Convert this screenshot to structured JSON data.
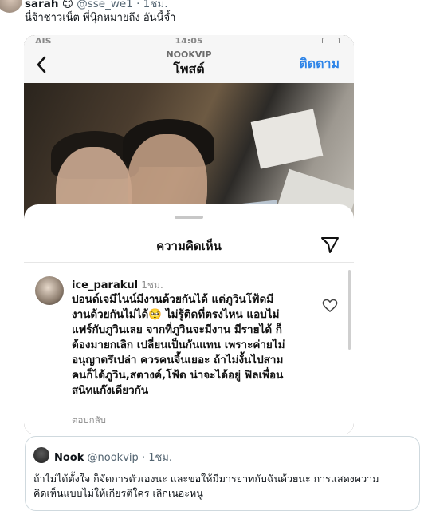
{
  "tweet": {
    "author_name": "sarah",
    "author_emoji": "😊",
    "handle": "@sse_we1",
    "time": "1ชม.",
    "text": "นี่จ้าชาวเน็ต พี่นุ๊กหมายถึง อันนี้จ้ำ"
  },
  "screenshot": {
    "status_bar": {
      "carrier": "AIS",
      "clock": "14:05"
    },
    "nav": {
      "username": "NOOKVIP",
      "page_title": "โพสต์",
      "follow_label": "ติดตาม"
    },
    "sheet_title": "ความคิดเห็น",
    "comment": {
      "username": "ice_parakul",
      "time": "1ชม.",
      "lines": [
        "ปอนด์เจมีไนน์มีงานด้วยกันได้ แต่ภูวินโฟ้ดมี",
        "งานด้วยกันไม่ได้🥺 ไม่รู้ติดที่ตรงไหน แอบไม่",
        "แฟร์กับภูวินเลย จากที่ภูวินจะมีงาน มีรายได้ ก็",
        "ต้องมายกเลิก เปลี่ยนเป็นกันแทน เพราะค่ายไม่",
        "อนุญาตรึเปล่า ควรคนจิ้นเยอะ ถ้าไม่งั้นไปสาม",
        "คนก็ได้ภูวิน,สตางค์,โฟ้ด น่าจะได้อยู่ ฟิลเพื่อน",
        "สนิทแก๊งเดียวกัน"
      ],
      "reply_label": "ตอบกลับ"
    },
    "icons": [
      "back-icon",
      "send-icon",
      "heart-icon"
    ]
  },
  "quote": {
    "author_name": "Nook",
    "handle": "@nookvip",
    "time": "1ชม.",
    "lines": [
      "ถ้าไม่ได้ตั้งใจ ก็จัดการตัวเองนะ และขอให้มีมารยาทกับฉันด้วยนะ การแสดงความ",
      "คิดเห็นแบบไม่ให้เกียรติใคร เลิกเนอะหนู"
    ]
  },
  "colors": {
    "link": "#2f85e8",
    "muted": "#536471",
    "text": "#0f1419"
  }
}
